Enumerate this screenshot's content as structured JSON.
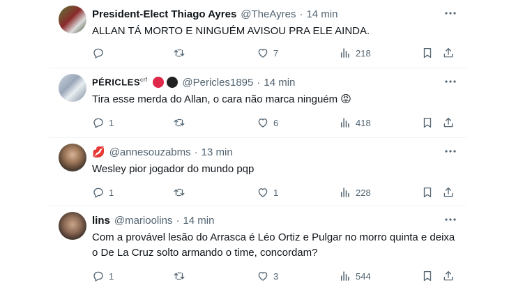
{
  "posts": [
    {
      "name": "President-Elect Thiago Ayres",
      "handle": "@TheAyres",
      "time": "14 min",
      "text": "ALLAN TÁ MORTO E NINGUÉM AVISOU PRA ELE AINDA.",
      "replies": "",
      "likes": "7",
      "views": "218"
    },
    {
      "name": "PÉRICLES",
      "name_sup": "crf",
      "handle": "@Pericles1895",
      "time": "14 min",
      "text": "Tira esse merda do Allan, o cara não marca ninguém 😡",
      "replies": "1",
      "likes": "6",
      "views": "418"
    },
    {
      "name": "💋",
      "handle": "@annesouzabms",
      "time": "13 min",
      "text": "Wesley pior jogador do mundo pqp",
      "replies": "1",
      "likes": "1",
      "views": "228"
    },
    {
      "name": "lins",
      "handle": "@marioolins",
      "time": "14 min",
      "text": "Com a provável lesão do Arrasca é Léo Ortiz e Pulgar no morro quinta e deixa o De La Cruz solto armando o time, concordam?",
      "replies": "1",
      "likes": "3",
      "views": "544"
    }
  ],
  "separator": "·",
  "icons": {
    "more": "more-horizontal-icon",
    "reply": "reply-icon",
    "retweet": "retweet-icon",
    "like": "heart-icon",
    "views": "views-chart-icon",
    "bookmark": "bookmark-icon",
    "share": "share-icon"
  },
  "colors": {
    "text": "#0f1419",
    "secondary": "#536471",
    "divider": "#eff3f4",
    "badge_red": "#e0284a",
    "badge_black": "#222222"
  }
}
